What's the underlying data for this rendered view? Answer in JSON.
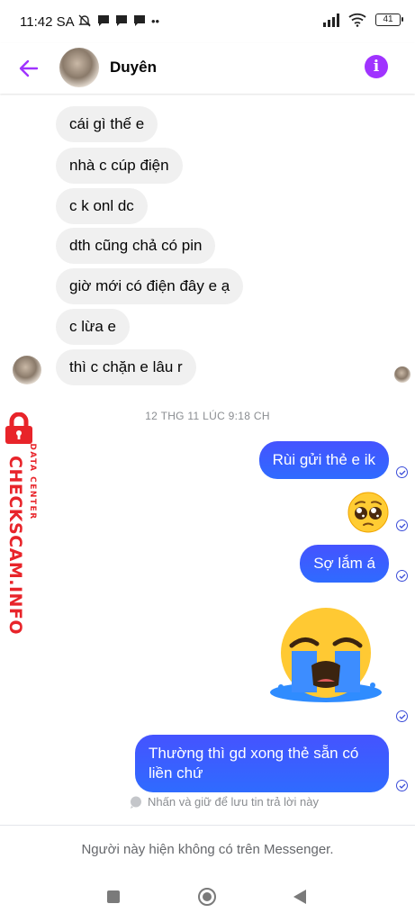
{
  "status_bar": {
    "time": "11:42 SA",
    "battery": "41"
  },
  "header": {
    "contact_name": "Duyên"
  },
  "messages_in": [
    "cái gì thế e",
    "nhà c cúp điện",
    "c k onl dc",
    "dth cũng chả có pin",
    "giờ mới có điện đây e ạ",
    "c lừa e",
    "thì c chặn e lâu r"
  ],
  "time_separator": "12 THG 11 LÚC 9:18 CH",
  "messages_out": [
    "Rùi gửi thẻ e ik",
    "Sợ lắm á",
    "Thường thì gd xong thẻ sẵn có liền chứ"
  ],
  "watermark": {
    "main": "CHECKSCAM.INFO",
    "sub": "DATA CENTER"
  },
  "hint": "Nhấn và giữ để lưu tin trả lời này",
  "footer": {
    "unavailable_text": "Người này hiện không có trên Messenger."
  },
  "colors": {
    "outgoing_bubble": "#3a5cff",
    "incoming_bubble": "#f0f0f0",
    "accent": "#a033ff",
    "watermark": "#e8242a"
  }
}
